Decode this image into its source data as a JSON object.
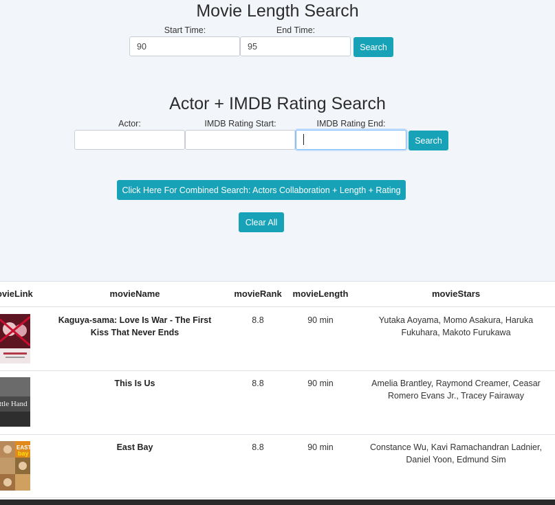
{
  "length_search": {
    "title": "Movie Length Search",
    "start_label": "Start Time:",
    "start_value": "90",
    "end_label": "End Time:",
    "end_value": "95",
    "search_label": "Search"
  },
  "actor_search": {
    "title": "Actor + IMDB Rating Search",
    "actor_label": "Actor:",
    "actor_value": "",
    "rating_start_label": "IMDB Rating Start:",
    "rating_start_value": "",
    "rating_end_label": "IMDB Rating End:",
    "rating_end_value": "",
    "search_label": "Search"
  },
  "combined_button_label": "Click Here For Combined Search: Actors Collaboration + Length + Rating",
  "clear_all_label": "Clear All",
  "table": {
    "columns": [
      "ovieLink",
      "movieName",
      "movieRank",
      "movieLength",
      "movieStars"
    ],
    "rows": [
      {
        "name": "Kaguya-sama: Love Is War - The First Kiss That Never Ends",
        "rank": "8.8",
        "length": "90 min",
        "stars": "Yutaka Aoyama, Momo Asakura, Haruka Fukuhara, Makoto Furukawa"
      },
      {
        "name": "This Is Us",
        "rank": "8.8",
        "length": "90 min",
        "stars": "Amelia Brantley, Raymond Creamer, Ceasar Romero Evans Jr., Tracey Fairaway"
      },
      {
        "name": "East Bay",
        "rank": "8.8",
        "length": "90 min",
        "stars": "Constance Wu, Kavi Ramachandran Ladnier, Daniel Yoon, Edmund Sim"
      }
    ]
  },
  "posters": [
    {
      "icon": "poster-kaguya",
      "accent": "#c8102e"
    },
    {
      "icon": "poster-little-hand",
      "text": "ittle Hand",
      "accent": "#555555"
    },
    {
      "icon": "poster-east-bay",
      "text": "EAST bay",
      "accent": "#e08a1e"
    }
  ],
  "colors": {
    "button": "#17a2b8",
    "background": "#f2f6fa"
  }
}
